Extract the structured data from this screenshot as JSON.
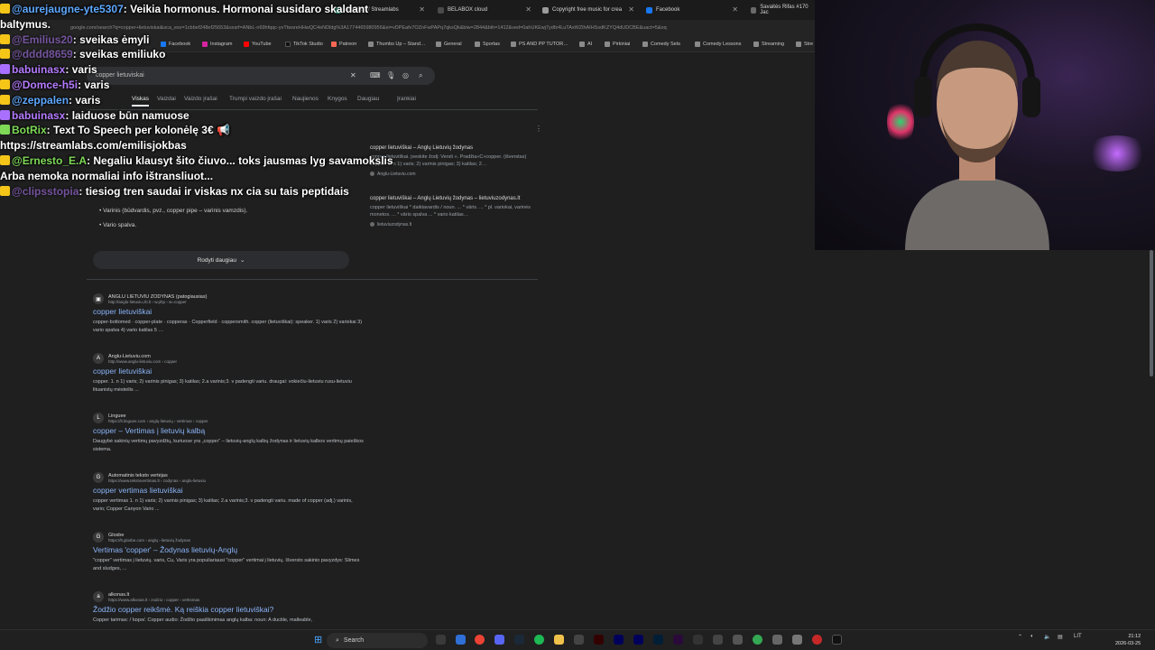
{
  "browser": {
    "tabs": [
      {
        "label": "Alert Box / Streamlabs",
        "color": "#31c3a2"
      },
      {
        "label": "BELABOX cloud",
        "color": "#4a4a4a"
      },
      {
        "label": "Copyright free music for crea",
        "color": "#9b9b9b"
      },
      {
        "label": "Facebook",
        "color": "#1877f2"
      },
      {
        "label": "Savaitės Rifas #170 Jac",
        "color": "#6a6a6a"
      }
    ],
    "url": "google.com/search?q=copper+lietuviskai&sca_esv=1cbbef248ef25653&sxsrf=ANbL-n69hfqqc-yvTtwsreHHwQC4eNDldg%3A1774465980956&ei=vDPEafv7OZnFwPAPq7qksQk&biw=2844&bih=1412&ved=0ahUKEwj7ydfz4LuTAxWZlhAIHSsdKZYQ4dUDCBE&uact=5&oq",
    "bookmarks": [
      "Facebook",
      "Instagram",
      "YouTube",
      "TikTok Studio",
      "Patreon",
      "Thumbs Up – Stand…",
      "General",
      "Sportas",
      "PS AND PP TUTOR…",
      "AI",
      "Pirkiniai",
      "Comedy Sets",
      "Comedy Lessons",
      "Streaming",
      "Stre"
    ]
  },
  "search": {
    "query": "copper lietuviskai",
    "filters": [
      "Viskas",
      "Vaizdai",
      "Vaizdo įrašai",
      "Trumpi vaizdo įrašai",
      "Naujienos",
      "Knygos",
      "Daugiau",
      "Įrankiai"
    ],
    "side_results": [
      {
        "title": "copper lietuviškai – Anglų Lietuvių žodynas",
        "snippet": "copper lietuviškai. įveskite žodį: Versti ». Pradžia»C»copper. (išverstas) copper. 1. n 1) varis; 2) varinis pinigas; 3) katilas; 2…",
        "source": "Anglu-Lietuviu.com"
      },
      {
        "title": "copper lietuviškai – Anglų Lietuvių žodynas – lietuviuzodynas.lt",
        "snippet": "copper lietuviškai * daiktavardis / noun. ... * vāris. ... * pl. variokai, varinės monetos. ... * vārio spalva ... * vario katilas…",
        "source": "lietuviuzodynas.lt"
      }
    ],
    "overview_items": [
      "Varinis (būdvardis, pvz., copper pipe – varinis vamzdis).",
      "Vario spalva."
    ],
    "show_more": "Rodyti daugiau",
    "results": [
      {
        "site": "ANGLU LIETUVIU ZODYNAS (patogiausias)",
        "url": "http://anglu-lietuviu.zb.lt › w.php › w=copper",
        "title": "copper lietuviškai",
        "snippet": "copper-bottomed · copper-plate · copperas · Copperfield · coppersmith. copper (lietuviškai): speaker. 1) varis 2) variokai 3) vario spalva 4) vario katilas 5 …",
        "fav": "▣"
      },
      {
        "site": "Anglu-Lietuviu.com",
        "url": "http://www.anglu-lietuviu.com › copper",
        "title": "copper lietuviškai",
        "snippet": "copper. 1. n 1) varis; 2) varinis pinigas; 3) katilas; 2.a varinis;3. v padengti variu. draugai: vokiečiu-lietuviu rusu-lietuviu lituanistų mėsteilis ...",
        "fav": "A"
      },
      {
        "site": "Linguee",
        "url": "https://lt.linguee.com › anglų-lietuvių › vertimas › copper",
        "title": "copper – Vertimas į lietuvių kalbą",
        "snippet": "Daugybė sakinių vertimų pavyzdžių, kuriuose yra „copper“ – lietuvių-anglų kalbų žodynas ir lietuvių kalbos vertimų paieškos sistema.",
        "fav": "L"
      },
      {
        "site": "Automatinis teksto vertėjas",
        "url": "https://www.tekstovertimas.lt › zodynas › anglu-lietuviu",
        "title": "copper vertimas lietuviškai",
        "snippet": "copper vertimas 1. n 1) varis; 2) varinis pinigas; 3) katilas; 2.a varinis;3. v padengti variu. made of copper (adj.) varinis, vario; Copper Canyon Vario ...",
        "fav": "G"
      },
      {
        "site": "Glosbe",
        "url": "https://lt.glosbe.com › anglų › lietuvių žodynas",
        "title": "Vertimas 'copper' – Žodynas lietuvių-Anglų",
        "snippet": "\"copper\" vertimas į lietuvių. varis, Cu, Varis yra populiariausi \"copper\" vertimai į lietuvių. Išversto sakinio pavyzdys: Slimes and sludges, ...",
        "fav": "G"
      },
      {
        "site": "alkonas.lt",
        "url": "https://www.alkonas.lt › zodzio › copper › verksmas",
        "title": "Žodžio copper reikšmė. Ką reiškia copper lietuviškai?",
        "snippet": "Copper tarimas: /ˈkɒpə/. Copper audio: Žodžio paaiškinimas anglų kalba: noun: A ductile, malleable,",
        "fav": "a"
      }
    ]
  },
  "chat": [
    {
      "user": "@aurejaugne-yte5307",
      "msg": ": Veikia hormonus. Hormonai susidaro skaldant",
      "style": "user-blue",
      "badge": "#f5c518"
    },
    {
      "user": "",
      "msg": "baltymus.",
      "style": "",
      "badge": ""
    },
    {
      "user": "@Emilius20",
      "msg": ": sveikas ėmyli",
      "style": "user-dim",
      "badge": "#f5c518"
    },
    {
      "user": "@dddd8659",
      "msg": ": sveikas emiliuko",
      "style": "user-dim",
      "badge": "#f5c518"
    },
    {
      "user": "babuinasx",
      "msg": ": varis",
      "style": "user-purple",
      "badge": "#a970ff"
    },
    {
      "user": "@Domce-h5i",
      "msg": ": varis",
      "style": "user-purple",
      "badge": "#f5c518"
    },
    {
      "user": "@zeppalen",
      "msg": ": varis",
      "style": "user-blue",
      "badge": "#f5c518"
    },
    {
      "user": "babuinasx",
      "msg": ": laiduose būn namuose",
      "style": "user-purple",
      "badge": "#a970ff"
    },
    {
      "user": "BotRix",
      "msg": ": Text To Speech per kolonėlę 3€ 📢",
      "style": "user-green",
      "badge": "#7ed957"
    },
    {
      "user": "",
      "msg": "https://streamlabs.com/emilisjokbas",
      "style": "",
      "badge": ""
    },
    {
      "user": "@Ernesto_E.A",
      "msg": ": Negaliu klausyt šito čiuvo... toks jausmas lyg savamokslis",
      "style": "user-green",
      "badge": "#f5c518"
    },
    {
      "user": "",
      "msg": "Arba nemoka normaliai info ištransliuot...",
      "style": "",
      "badge": ""
    },
    {
      "user": "@clipsstopia",
      "msg": ": tiesiog tren saudai ir viskas nx cia su tais peptidais",
      "style": "user-dim",
      "badge": "#f5c518"
    }
  ],
  "taskbar": {
    "search": "Search",
    "lang": "LIT",
    "time": "21:12",
    "date": "2026-03-25"
  }
}
